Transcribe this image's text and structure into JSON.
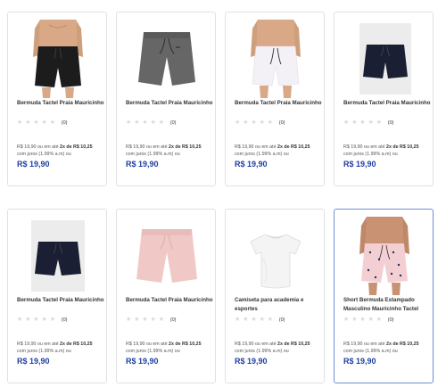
{
  "products": [
    {
      "name": "Bermuda Tactel Praia Mauricinho",
      "reviews": "(0)",
      "installment_prefix": "R$ 19,90 ou em até",
      "installment_bold": "2x de R$ 10,25",
      "installment_suffix": "com juros (1.99% a.m) ou",
      "price": "R$ 19,90"
    },
    {
      "name": "Bermuda Tactel Praia Mauricinho",
      "reviews": "(0)",
      "installment_prefix": "R$ 19,90 ou em até",
      "installment_bold": "2x de R$ 10,25",
      "installment_suffix": "com juros (1.99% a.m) ou",
      "price": "R$ 19,90"
    },
    {
      "name": "Bermuda Tactel Praia Mauricinho",
      "reviews": "(0)",
      "installment_prefix": "R$ 19,90 ou em até",
      "installment_bold": "2x de R$ 10,25",
      "installment_suffix": "com juros (1.99% a.m) ou",
      "price": "R$ 19,90"
    },
    {
      "name": "Bermuda Tactel Praia Mauricinho",
      "reviews": "(0)",
      "installment_prefix": "R$ 19,90 ou em até",
      "installment_bold": "2x de R$ 10,25",
      "installment_suffix": "com juros (1.99% a.m) ou",
      "price": "R$ 19,90"
    },
    {
      "name": "Bermuda Tactel Praia Mauricinho",
      "reviews": "(0)",
      "installment_prefix": "R$ 19,90 ou em até",
      "installment_bold": "2x de R$ 10,25",
      "installment_suffix": "com juros (1.99% a.m) ou",
      "price": "R$ 19,90"
    },
    {
      "name": "Bermuda Tactel Praia Mauricinho",
      "reviews": "(0)",
      "installment_prefix": "R$ 19,90 ou em até",
      "installment_bold": "2x de R$ 10,25",
      "installment_suffix": "com juros (1.99% a.m) ou",
      "price": "R$ 19,90"
    },
    {
      "name": "Camiseta para academia e esportes",
      "reviews": "(0)",
      "installment_prefix": "R$ 19,90 ou em até",
      "installment_bold": "2x de R$ 10,25",
      "installment_suffix": "com juros (1.99% a.m) ou",
      "price": "R$ 19,90"
    },
    {
      "name": "Short Bermuda Estampado Masculino Mauricinho Tactel",
      "reviews": "(0)",
      "installment_prefix": "R$ 19,90 ou em até",
      "installment_bold": "2x de R$ 10,25",
      "installment_suffix": "com juros (1.99% a.m) ou",
      "price": "R$ 19,90"
    }
  ],
  "colors": {
    "price": "#1f3fa3",
    "active_border": "#6c8fd8",
    "star_empty": "#d9d9d9"
  }
}
